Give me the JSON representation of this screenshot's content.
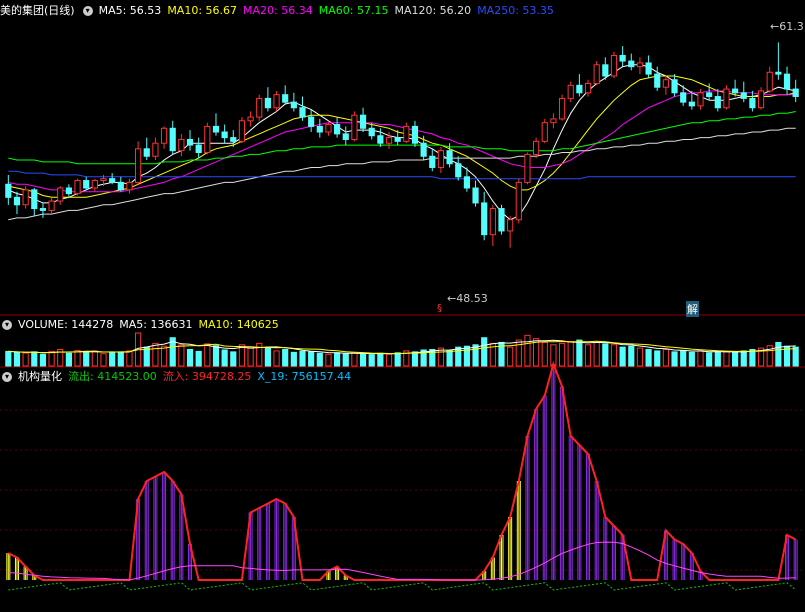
{
  "colors": {
    "up": "#ff3232",
    "down": "#54fcfc",
    "ma5": "#ffffff",
    "ma10": "#ffff00",
    "ma20": "#ff00ff",
    "ma60": "#00ff00",
    "ma120": "#dddddd",
    "ma250": "#2b4bff",
    "flow_out": "#00cc00",
    "flow_in": "#ff2222",
    "x19": "#00bfff",
    "purple": "#8a2be2",
    "yellow": "#ffff33"
  },
  "price_header": {
    "title": "美的集团(日线)",
    "ma5": "MA5: 56.53",
    "ma10": "MA10: 56.67",
    "ma20": "MA20: 56.34",
    "ma60": "MA60: 57.15",
    "ma120": "MA120: 56.20",
    "ma250": "MA250: 53.35"
  },
  "volume_header": {
    "title": "VOLUME: 144278",
    "ma5": "MA5: 136631",
    "ma10": "MA10: 140625"
  },
  "indicator_header": {
    "title": "机构量化",
    "out": "流出: 414523.00",
    "in": "流入: 394728.25",
    "x19": "X_19: 756157.44"
  },
  "markers": {
    "high": "61.3",
    "low": "48.53",
    "tag_s": "§",
    "tag_jie": "解"
  },
  "chart_data": {
    "type": "candlestick",
    "ylim": [
      47.5,
      62.5
    ],
    "candles": [
      [
        53.7,
        54.2,
        52.6,
        53.0
      ],
      [
        53.0,
        53.3,
        52.1,
        52.6
      ],
      [
        52.6,
        53.6,
        52.4,
        53.4
      ],
      [
        53.4,
        53.5,
        52.0,
        52.4
      ],
      [
        52.4,
        52.7,
        51.9,
        52.3
      ],
      [
        52.3,
        53.0,
        52.1,
        52.8
      ],
      [
        52.8,
        53.6,
        52.6,
        53.5
      ],
      [
        53.5,
        53.7,
        53.0,
        53.2
      ],
      [
        53.2,
        54.0,
        53.1,
        53.9
      ],
      [
        53.9,
        54.1,
        53.4,
        53.5
      ],
      [
        53.5,
        54.0,
        53.3,
        53.9
      ],
      [
        53.9,
        54.2,
        53.6,
        54.0
      ],
      [
        54.0,
        54.3,
        53.7,
        53.8
      ],
      [
        53.8,
        54.1,
        53.3,
        53.4
      ],
      [
        53.4,
        54.0,
        53.2,
        53.8
      ],
      [
        53.8,
        56.0,
        53.7,
        55.6
      ],
      [
        55.6,
        56.2,
        55.0,
        55.2
      ],
      [
        55.2,
        56.2,
        55.0,
        55.9
      ],
      [
        55.9,
        56.8,
        55.6,
        56.7
      ],
      [
        56.7,
        57.1,
        55.3,
        55.5
      ],
      [
        55.5,
        56.4,
        55.2,
        56.1
      ],
      [
        56.1,
        56.6,
        55.5,
        55.8
      ],
      [
        55.8,
        56.2,
        55.1,
        55.4
      ],
      [
        55.4,
        57.0,
        55.3,
        56.8
      ],
      [
        56.8,
        57.5,
        56.3,
        56.5
      ],
      [
        56.5,
        56.9,
        55.9,
        56.2
      ],
      [
        56.2,
        56.6,
        55.7,
        56.0
      ],
      [
        56.0,
        57.3,
        55.9,
        57.1
      ],
      [
        57.1,
        57.6,
        56.8,
        57.3
      ],
      [
        57.3,
        58.5,
        57.1,
        58.3
      ],
      [
        58.3,
        58.9,
        57.6,
        57.8
      ],
      [
        57.8,
        58.7,
        57.6,
        58.5
      ],
      [
        58.5,
        59.0,
        58.0,
        58.1
      ],
      [
        58.1,
        58.6,
        57.6,
        57.8
      ],
      [
        57.8,
        58.4,
        57.1,
        57.3
      ],
      [
        57.3,
        57.7,
        56.5,
        56.8
      ],
      [
        56.8,
        57.2,
        56.2,
        56.5
      ],
      [
        56.5,
        57.1,
        56.3,
        56.9
      ],
      [
        56.9,
        57.3,
        56.2,
        56.4
      ],
      [
        56.4,
        56.8,
        55.8,
        56.1
      ],
      [
        56.1,
        57.6,
        56.0,
        57.4
      ],
      [
        57.4,
        57.8,
        56.5,
        56.7
      ],
      [
        56.7,
        57.0,
        56.1,
        56.3
      ],
      [
        56.3,
        56.7,
        55.7,
        55.9
      ],
      [
        55.9,
        56.5,
        55.6,
        56.2
      ],
      [
        56.2,
        56.6,
        55.8,
        56.0
      ],
      [
        56.0,
        57.0,
        55.9,
        56.8
      ],
      [
        56.8,
        57.1,
        55.7,
        55.9
      ],
      [
        55.9,
        56.3,
        55.0,
        55.2
      ],
      [
        55.2,
        55.6,
        54.4,
        54.6
      ],
      [
        54.6,
        55.7,
        54.3,
        55.5
      ],
      [
        55.5,
        55.9,
        54.6,
        54.8
      ],
      [
        54.8,
        55.2,
        53.9,
        54.1
      ],
      [
        54.1,
        54.6,
        53.3,
        53.5
      ],
      [
        53.5,
        53.9,
        52.5,
        52.7
      ],
      [
        52.7,
        53.3,
        50.7,
        51.0
      ],
      [
        51.0,
        52.6,
        50.4,
        52.4
      ],
      [
        52.4,
        52.6,
        51.0,
        51.2
      ],
      [
        51.2,
        52.0,
        50.3,
        51.8
      ],
      [
        51.8,
        54.0,
        51.6,
        53.8
      ],
      [
        53.8,
        55.4,
        53.7,
        55.3
      ],
      [
        55.3,
        56.2,
        55.1,
        56.0
      ],
      [
        56.0,
        57.2,
        55.9,
        57.0
      ],
      [
        57.0,
        57.5,
        56.7,
        57.2
      ],
      [
        57.2,
        58.5,
        57.1,
        58.3
      ],
      [
        58.3,
        59.2,
        58.1,
        59.0
      ],
      [
        59.0,
        59.6,
        58.4,
        58.6
      ],
      [
        58.6,
        59.3,
        58.4,
        59.1
      ],
      [
        59.1,
        60.3,
        59.0,
        60.1
      ],
      [
        60.1,
        60.5,
        59.3,
        59.5
      ],
      [
        59.5,
        60.8,
        59.4,
        60.6
      ],
      [
        60.6,
        61.1,
        60.0,
        60.3
      ],
      [
        60.3,
        60.7,
        59.8,
        60.0
      ],
      [
        60.0,
        60.5,
        59.6,
        60.2
      ],
      [
        60.2,
        60.6,
        59.4,
        59.6
      ],
      [
        59.6,
        60.0,
        58.7,
        58.9
      ],
      [
        58.9,
        59.5,
        58.5,
        59.3
      ],
      [
        59.3,
        59.6,
        58.4,
        58.6
      ],
      [
        58.6,
        59.0,
        57.9,
        58.1
      ],
      [
        58.1,
        58.7,
        57.7,
        57.9
      ],
      [
        57.9,
        58.8,
        57.7,
        58.6
      ],
      [
        58.6,
        59.1,
        58.2,
        58.4
      ],
      [
        58.4,
        58.8,
        57.6,
        57.8
      ],
      [
        57.8,
        59.0,
        57.7,
        58.8
      ],
      [
        58.8,
        59.3,
        58.4,
        58.6
      ],
      [
        58.6,
        59.2,
        58.1,
        58.3
      ],
      [
        58.3,
        58.7,
        57.6,
        57.8
      ],
      [
        57.8,
        58.9,
        57.7,
        58.7
      ],
      [
        58.7,
        60.0,
        58.6,
        59.7
      ],
      [
        59.7,
        61.3,
        59.3,
        59.6
      ],
      [
        59.6,
        60.0,
        58.5,
        58.8
      ],
      [
        58.8,
        59.3,
        58.1,
        58.4
      ]
    ],
    "volume": [
      62,
      58,
      55,
      60,
      50,
      62,
      70,
      54,
      66,
      60,
      64,
      52,
      58,
      60,
      64,
      140,
      80,
      96,
      84,
      120,
      90,
      70,
      62,
      94,
      86,
      68,
      60,
      90,
      76,
      96,
      80,
      64,
      70,
      58,
      62,
      60,
      54,
      50,
      56,
      52,
      58,
      50,
      48,
      54,
      50,
      56,
      64,
      60,
      68,
      70,
      76,
      66,
      80,
      84,
      90,
      120,
      96,
      100,
      80,
      110,
      130,
      116,
      100,
      90,
      96,
      104,
      110,
      90,
      100,
      94,
      90,
      80,
      84,
      76,
      70,
      64,
      70,
      60,
      66,
      58,
      64,
      56,
      62,
      60,
      58,
      64,
      70,
      76,
      86,
      100,
      84,
      80
    ],
    "series": [
      {
        "name": "MA5",
        "values": [
          53.4,
          53.2,
          53.1,
          52.9,
          52.7,
          52.7,
          52.9,
          53.0,
          53.2,
          53.4,
          53.6,
          53.7,
          53.8,
          53.8,
          53.7,
          54.1,
          54.3,
          54.6,
          55.0,
          55.3,
          55.5,
          55.9,
          55.9,
          55.9,
          55.9,
          55.9,
          55.9,
          56.2,
          56.6,
          57.0,
          57.3,
          57.6,
          58.0,
          58.1,
          57.9,
          57.7,
          57.4,
          57.1,
          56.8,
          56.5,
          56.6,
          56.6,
          56.6,
          56.5,
          56.3,
          56.2,
          56.2,
          56.1,
          55.8,
          55.6,
          55.3,
          55.0,
          54.8,
          54.5,
          54.1,
          53.5,
          52.8,
          52.2,
          51.8,
          52.0,
          52.7,
          53.6,
          54.5,
          55.6,
          56.6,
          57.5,
          58.2,
          58.7,
          59.1,
          59.4,
          59.7,
          60.0,
          60.1,
          60.1,
          60.0,
          59.7,
          59.5,
          59.2,
          58.9,
          58.6,
          58.4,
          58.2,
          58.2,
          58.2,
          58.3,
          58.4,
          58.4,
          58.5,
          58.7,
          58.9,
          58.8,
          58.7
        ]
      },
      {
        "name": "MA10",
        "values": [
          53.6,
          53.5,
          53.4,
          53.3,
          53.1,
          53.0,
          53.0,
          53.0,
          53.0,
          53.0,
          53.1,
          53.2,
          53.3,
          53.4,
          53.5,
          53.7,
          53.9,
          54.1,
          54.3,
          54.5,
          54.7,
          54.9,
          55.1,
          55.4,
          55.6,
          55.7,
          55.8,
          56.0,
          56.2,
          56.4,
          56.6,
          56.8,
          57.0,
          57.2,
          57.3,
          57.4,
          57.4,
          57.4,
          57.3,
          57.2,
          57.1,
          57.0,
          56.9,
          56.8,
          56.7,
          56.5,
          56.4,
          56.3,
          56.1,
          55.9,
          55.8,
          55.6,
          55.4,
          55.2,
          54.9,
          54.6,
          54.3,
          53.9,
          53.6,
          53.4,
          53.4,
          53.6,
          53.9,
          54.3,
          54.8,
          55.4,
          56.0,
          56.6,
          57.2,
          57.7,
          58.2,
          58.6,
          59.0,
          59.3,
          59.4,
          59.5,
          59.5,
          59.5,
          59.4,
          59.3,
          59.1,
          58.9,
          58.7,
          58.6,
          58.5,
          58.4,
          58.4,
          58.4,
          58.4,
          58.5,
          58.5,
          58.6
        ]
      },
      {
        "name": "MA20",
        "values": [
          53.8,
          53.7,
          53.7,
          53.6,
          53.5,
          53.4,
          53.4,
          53.3,
          53.3,
          53.3,
          53.3,
          53.3,
          53.3,
          53.3,
          53.4,
          53.5,
          53.6,
          53.7,
          53.8,
          54.0,
          54.1,
          54.3,
          54.5,
          54.7,
          54.9,
          55.1,
          55.3,
          55.5,
          55.7,
          55.9,
          56.1,
          56.3,
          56.5,
          56.6,
          56.7,
          56.8,
          56.9,
          57.0,
          57.0,
          57.0,
          57.0,
          57.0,
          57.0,
          56.9,
          56.9,
          56.8,
          56.7,
          56.6,
          56.5,
          56.4,
          56.2,
          56.1,
          55.9,
          55.8,
          55.6,
          55.4,
          55.2,
          55.0,
          54.8,
          54.7,
          54.6,
          54.6,
          54.6,
          54.7,
          54.8,
          55.0,
          55.3,
          55.6,
          55.9,
          56.2,
          56.5,
          56.9,
          57.2,
          57.5,
          57.8,
          58.0,
          58.2,
          58.4,
          58.5,
          58.6,
          58.6,
          58.7,
          58.7,
          58.7,
          58.6,
          58.6,
          58.6,
          58.5,
          58.5,
          58.5,
          58.5,
          58.5
        ]
      },
      {
        "name": "MA60",
        "values": [
          55.1,
          55.0,
          55.0,
          55.0,
          54.9,
          54.9,
          54.9,
          54.9,
          54.8,
          54.8,
          54.8,
          54.8,
          54.8,
          54.8,
          54.8,
          54.8,
          54.8,
          54.8,
          54.9,
          54.9,
          54.9,
          55.0,
          55.0,
          55.0,
          55.1,
          55.1,
          55.2,
          55.2,
          55.3,
          55.3,
          55.4,
          55.5,
          55.5,
          55.6,
          55.6,
          55.7,
          55.7,
          55.7,
          55.8,
          55.8,
          55.8,
          55.8,
          55.8,
          55.8,
          55.8,
          55.8,
          55.8,
          55.8,
          55.8,
          55.8,
          55.8,
          55.7,
          55.7,
          55.7,
          55.7,
          55.6,
          55.6,
          55.6,
          55.5,
          55.5,
          55.5,
          55.5,
          55.5,
          55.5,
          55.6,
          55.6,
          55.7,
          55.8,
          55.9,
          56.0,
          56.1,
          56.2,
          56.3,
          56.4,
          56.5,
          56.6,
          56.7,
          56.8,
          56.9,
          57.0,
          57.0,
          57.1,
          57.1,
          57.2,
          57.2,
          57.3,
          57.3,
          57.4,
          57.4,
          57.5,
          57.5,
          57.6
        ]
      },
      {
        "name": "MA120",
        "values": [
          51.8,
          51.9,
          51.9,
          52.0,
          52.1,
          52.1,
          52.2,
          52.3,
          52.3,
          52.4,
          52.5,
          52.6,
          52.6,
          52.7,
          52.8,
          52.9,
          53.0,
          53.1,
          53.2,
          53.2,
          53.3,
          53.4,
          53.5,
          53.6,
          53.7,
          53.8,
          53.8,
          53.9,
          54.0,
          54.1,
          54.2,
          54.3,
          54.4,
          54.4,
          54.5,
          54.6,
          54.6,
          54.7,
          54.7,
          54.8,
          54.8,
          54.8,
          54.9,
          54.9,
          54.9,
          55.0,
          55.0,
          55.0,
          55.0,
          55.1,
          55.1,
          55.1,
          55.1,
          55.1,
          55.1,
          55.1,
          55.1,
          55.1,
          55.1,
          55.2,
          55.2,
          55.2,
          55.3,
          55.3,
          55.4,
          55.4,
          55.5,
          55.5,
          55.6,
          55.6,
          55.7,
          55.7,
          55.8,
          55.8,
          55.9,
          55.9,
          56.0,
          56.0,
          56.1,
          56.1,
          56.2,
          56.2,
          56.3,
          56.3,
          56.4,
          56.4,
          56.5,
          56.5,
          56.6,
          56.6,
          56.7,
          56.7
        ]
      },
      {
        "name": "MA250",
        "values": [
          54.4,
          54.4,
          54.3,
          54.3,
          54.3,
          54.2,
          54.2,
          54.2,
          54.2,
          54.1,
          54.1,
          54.1,
          54.1,
          54.1,
          54.1,
          54.1,
          54.1,
          54.1,
          54.1,
          54.1,
          54.1,
          54.1,
          54.1,
          54.1,
          54.1,
          54.1,
          54.1,
          54.1,
          54.1,
          54.1,
          54.1,
          54.1,
          54.1,
          54.1,
          54.1,
          54.1,
          54.1,
          54.1,
          54.1,
          54.1,
          54.1,
          54.1,
          54.1,
          54.1,
          54.1,
          54.1,
          54.1,
          54.1,
          54.1,
          54.1,
          54.0,
          54.0,
          54.0,
          54.0,
          54.0,
          54.0,
          54.0,
          54.0,
          54.0,
          54.0,
          54.0,
          54.0,
          54.0,
          54.0,
          54.0,
          54.0,
          54.0,
          54.1,
          54.1,
          54.1,
          54.1,
          54.1,
          54.1,
          54.1,
          54.1,
          54.1,
          54.1,
          54.1,
          54.1,
          54.1,
          54.1,
          54.1,
          54.1,
          54.1,
          54.1,
          54.1,
          54.1,
          54.1,
          54.1,
          54.1,
          54.1,
          54.1
        ]
      }
    ],
    "flow": [
      30,
      25,
      15,
      5,
      0,
      0,
      0,
      0,
      0,
      0,
      0,
      0,
      0,
      0,
      0,
      90,
      110,
      115,
      120,
      110,
      95,
      40,
      0,
      0,
      0,
      0,
      0,
      0,
      75,
      80,
      85,
      90,
      85,
      70,
      0,
      0,
      0,
      10,
      15,
      5,
      0,
      0,
      0,
      0,
      0,
      0,
      0,
      0,
      0,
      0,
      0,
      0,
      0,
      0,
      0,
      10,
      25,
      50,
      70,
      110,
      160,
      190,
      205,
      240,
      215,
      160,
      150,
      140,
      110,
      70,
      60,
      50,
      0,
      0,
      0,
      0,
      55,
      45,
      40,
      30,
      10,
      0,
      0,
      0,
      0,
      0,
      0,
      0,
      0,
      0,
      50,
      45
    ],
    "flow_color": [
      "y",
      "y",
      "y",
      "y",
      "n",
      "n",
      "n",
      "n",
      "n",
      "n",
      "n",
      "n",
      "n",
      "n",
      "n",
      "p",
      "p",
      "p",
      "p",
      "p",
      "p",
      "p",
      "n",
      "n",
      "n",
      "n",
      "n",
      "n",
      "p",
      "p",
      "p",
      "p",
      "p",
      "p",
      "n",
      "n",
      "n",
      "y",
      "y",
      "y",
      "n",
      "n",
      "n",
      "n",
      "n",
      "n",
      "n",
      "n",
      "n",
      "n",
      "n",
      "n",
      "n",
      "n",
      "n",
      "y",
      "y",
      "y",
      "y",
      "y",
      "p",
      "p",
      "p",
      "p",
      "p",
      "p",
      "p",
      "p",
      "p",
      "p",
      "p",
      "p",
      "n",
      "n",
      "n",
      "n",
      "p",
      "p",
      "p",
      "p",
      "p",
      "n",
      "n",
      "n",
      "n",
      "n",
      "n",
      "n",
      "n",
      "n",
      "p",
      "p"
    ]
  }
}
